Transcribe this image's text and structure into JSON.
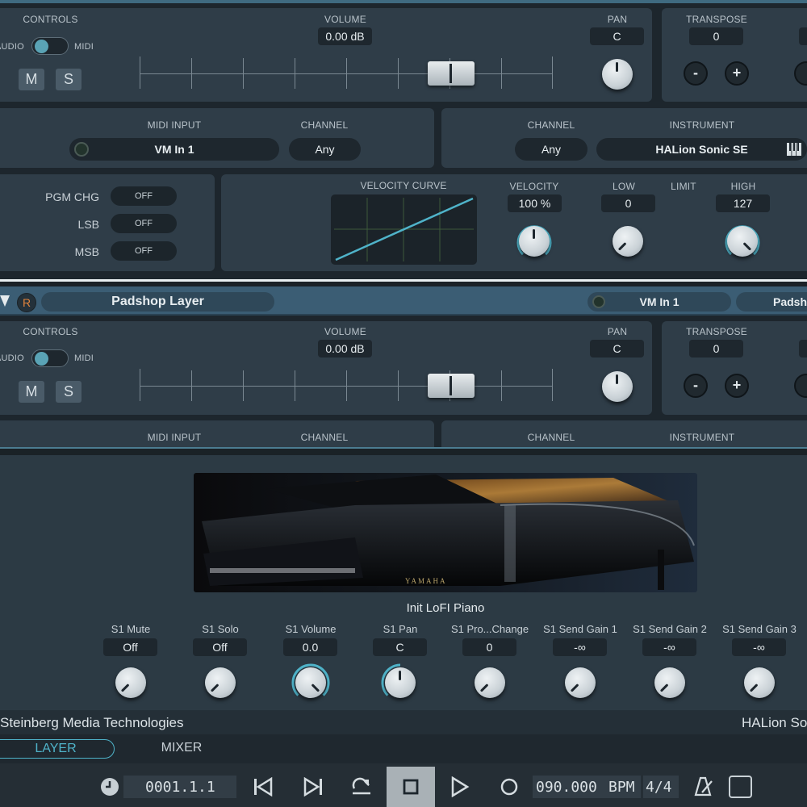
{
  "track1": {
    "controls_label": "CONTROLS",
    "audio_label": "AUDIO",
    "midi_label": "MIDI",
    "mute_label": "M",
    "solo_label": "S",
    "volume_label": "VOLUME",
    "volume_value": "0.00 dB",
    "pan_label": "PAN",
    "pan_value": "C",
    "transpose_label": "TRANSPOSE",
    "transpose_value": "0",
    "minus_label": "-",
    "plus_label": "+",
    "midi_input_label": "MIDI INPUT",
    "midi_input_value": "VM In 1",
    "channel_label": "CHANNEL",
    "channel_value": "Any",
    "out_channel_label": "CHANNEL",
    "out_channel_value": "Any",
    "instrument_label": "INSTRUMENT",
    "instrument_value": "HALion Sonic SE",
    "pgm_chg_label": "PGM CHG",
    "pgm_chg_value": "OFF",
    "lsb_label": "LSB",
    "lsb_value": "OFF",
    "msb_label": "MSB",
    "msb_value": "OFF",
    "velocity_curve_label": "VELOCITY CURVE",
    "velocity_label": "VELOCITY",
    "velocity_value": "100 %",
    "low_label": "LOW",
    "low_value": "0",
    "limit_label": "LIMIT",
    "high_label": "HIGH",
    "high_value": "127"
  },
  "track2": {
    "header": {
      "rec_label": "R",
      "name": "Padshop Layer",
      "midi_input": "VM In 1",
      "instrument_short": "Padsh"
    },
    "controls_label": "CONTROLS",
    "audio_label": "AUDIO",
    "midi_label": "MIDI",
    "mute_label": "M",
    "solo_label": "S",
    "volume_label": "VOLUME",
    "volume_value": "0.00 dB",
    "pan_label": "PAN",
    "pan_value": "C",
    "transpose_label": "TRANSPOSE",
    "transpose_value": "0",
    "minus_label": "-",
    "plus_label": "+",
    "midi_input_label": "MIDI INPUT",
    "channel_label": "CHANNEL",
    "out_channel_label": "CHANNEL",
    "instrument_label": "INSTRUMENT"
  },
  "instrument_panel": {
    "program_name": "Init LoFI Piano",
    "image_brand": "YAMAHA",
    "params": [
      {
        "label": "S1 Mute",
        "value": "Off",
        "level": 0.0
      },
      {
        "label": "S1 Solo",
        "value": "Off",
        "level": 0.0
      },
      {
        "label": "S1 Volume",
        "value": "0.0",
        "level": 1.0
      },
      {
        "label": "S1 Pan",
        "value": "C",
        "level": 0.5
      },
      {
        "label": "S1 Pro...Change",
        "value": "0",
        "level": 0.0
      },
      {
        "label": "S1 Send Gain 1",
        "value": "-∞",
        "level": 0.0
      },
      {
        "label": "S1 Send Gain 2",
        "value": "-∞",
        "level": 0.0
      },
      {
        "label": "S1 Send Gain 3",
        "value": "-∞",
        "level": 0.0
      }
    ],
    "vendor": "Steinberg Media Technologies",
    "product_short": "HALion So"
  },
  "tabs": {
    "layer": "LAYER",
    "mixer": "MIXER"
  },
  "transport": {
    "position": "0001.1.1",
    "tempo": "090.000",
    "bpm_label": "BPM",
    "signature": "4/4"
  },
  "colors": {
    "accent": "#4fb3c9",
    "panel": "#2f3d48",
    "background": "#1d262d"
  }
}
